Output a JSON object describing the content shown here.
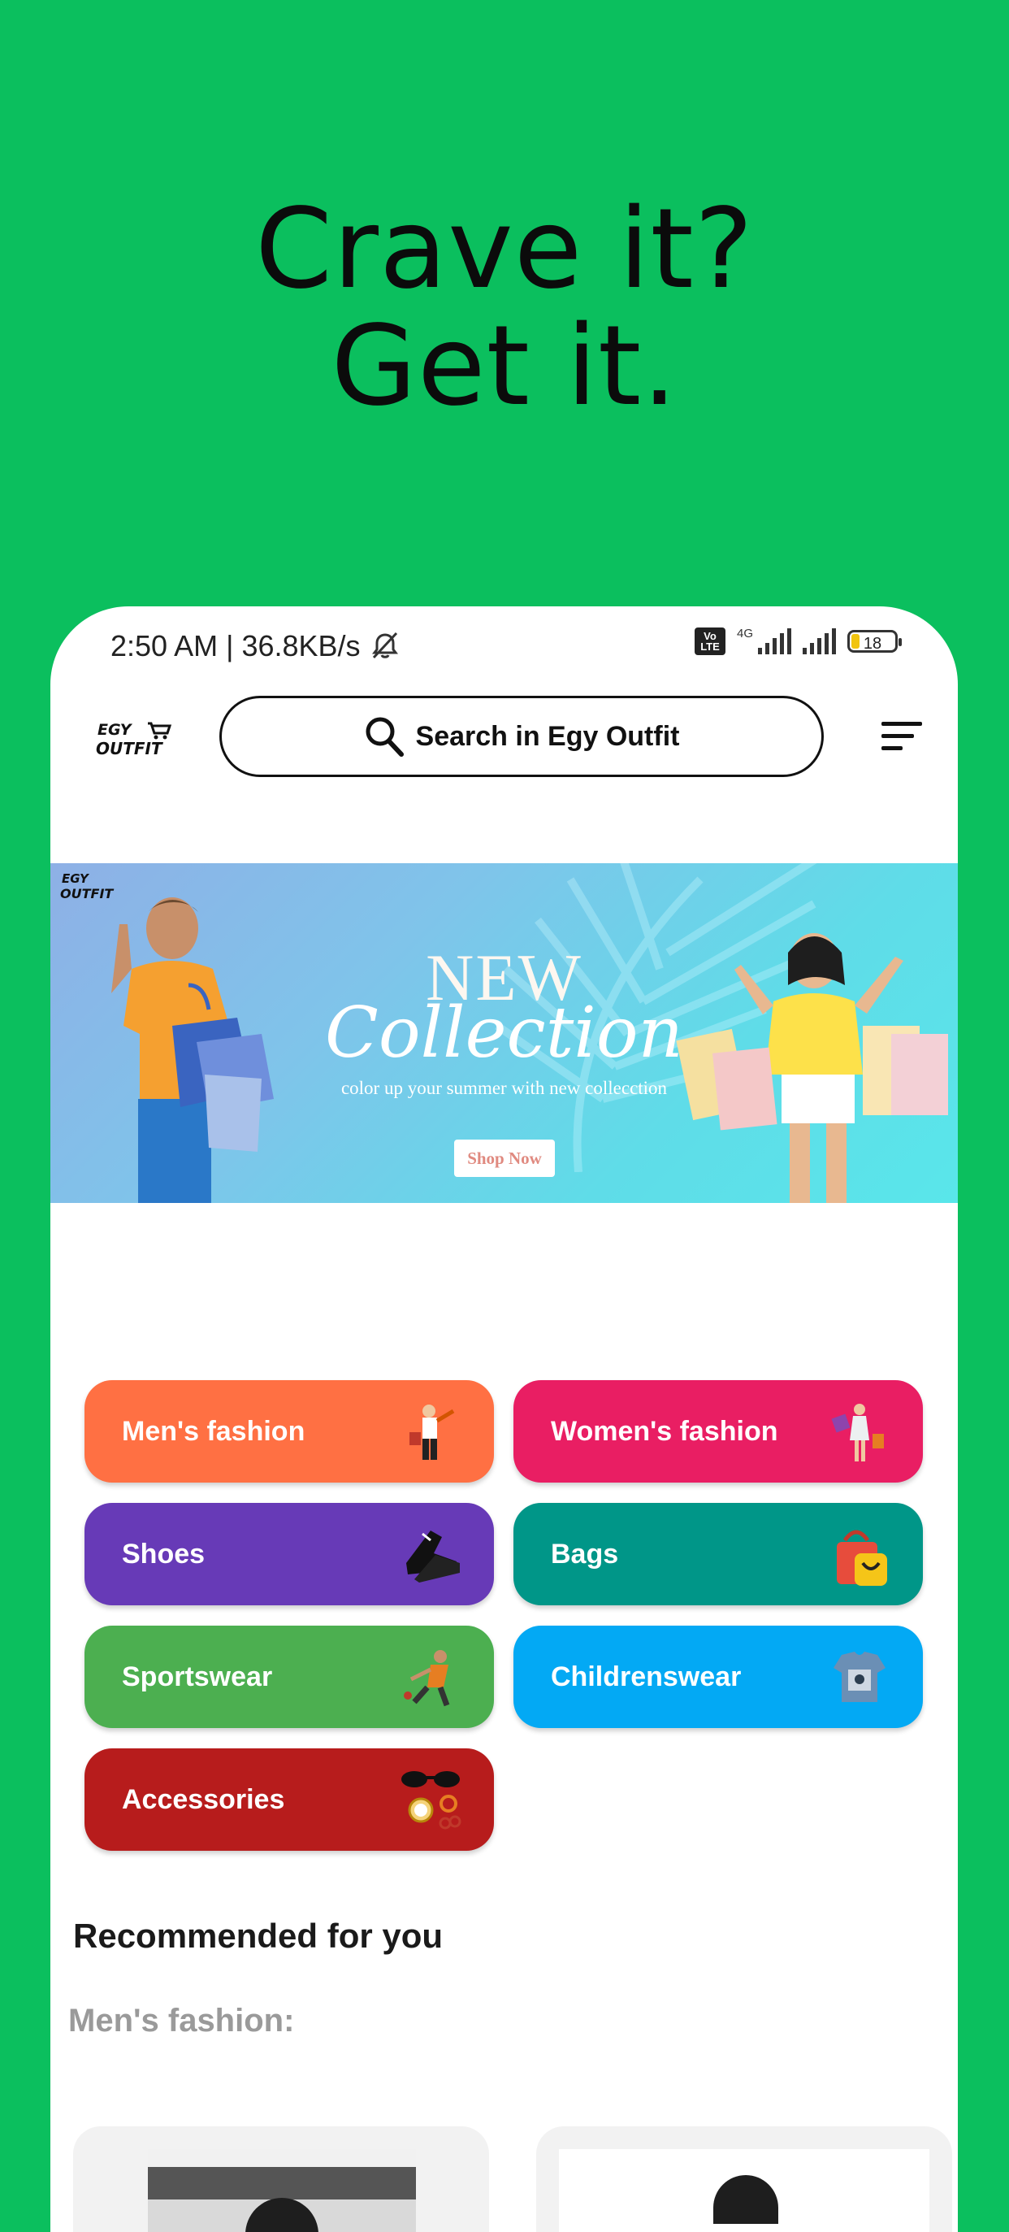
{
  "hero": {
    "line1": "Crave it?",
    "line2": "Get it."
  },
  "status_bar": {
    "time_speed": "2:50 AM | 36.8KB/s",
    "volte": "Vo LTE",
    "network": "4G",
    "battery": "18"
  },
  "app_bar": {
    "search_label": "Search in Egy Outfit",
    "logo_text": "EGY OUTFIT"
  },
  "banner": {
    "title": "NEW",
    "subtitle": "Collection",
    "tagline": "color up your summer with new collecction",
    "button": "Shop Now",
    "logo_text": "EGY OUTFIT"
  },
  "categories": [
    {
      "label": "Men's fashion",
      "color": "#ff7043",
      "icon": "mens-fashion-icon"
    },
    {
      "label": "Women's fashion",
      "color": "#e91e63",
      "icon": "womens-fashion-icon"
    },
    {
      "label": "Shoes",
      "color": "#673ab7",
      "icon": "shoes-icon"
    },
    {
      "label": "Bags",
      "color": "#009688",
      "icon": "bags-icon"
    },
    {
      "label": "Sportswear",
      "color": "#4caf50",
      "icon": "sportswear-icon"
    },
    {
      "label": "Childrenswear",
      "color": "#03a9f4",
      "icon": "childrenswear-icon"
    },
    {
      "label": "Accessories",
      "color": "#b71c1c",
      "icon": "accessories-icon"
    }
  ],
  "recommended": {
    "title": "Recommended for you",
    "section": "Men's fashion:"
  },
  "colors": {
    "background": "#0bbf5e"
  }
}
